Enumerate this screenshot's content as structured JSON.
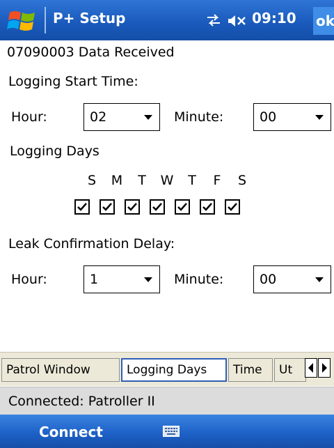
{
  "titlebar": {
    "title": "P+ Setup",
    "time": "09:10",
    "ok_label": "ok",
    "icons": [
      "windows-start-icon",
      "connectivity-icon",
      "volume-muted-icon"
    ]
  },
  "status_message": "07090003 Data Received",
  "logging_start": {
    "label": "Logging Start Time:",
    "hour_label": "Hour:",
    "hour_value": "02",
    "minute_label": "Minute:",
    "minute_value": "00"
  },
  "logging_days": {
    "label": "Logging Days",
    "days": [
      {
        "letter": "S",
        "checked": true
      },
      {
        "letter": "M",
        "checked": true
      },
      {
        "letter": "T",
        "checked": true
      },
      {
        "letter": "W",
        "checked": true
      },
      {
        "letter": "T",
        "checked": true
      },
      {
        "letter": "F",
        "checked": true
      },
      {
        "letter": "S",
        "checked": true
      }
    ]
  },
  "leak_delay": {
    "label": "Leak Confirmation Delay:",
    "hour_label": "Hour:",
    "hour_value": "1",
    "minute_label": "Minute:",
    "minute_value": "00"
  },
  "tabs": [
    {
      "label": "Patrol Window",
      "active": false
    },
    {
      "label": "Logging Days",
      "active": true
    },
    {
      "label": "Time",
      "active": false
    },
    {
      "label": "Ut",
      "active": false
    }
  ],
  "connection_status": "Connected: Patroller II",
  "menu": {
    "connect_label": "Connect",
    "keyboard_icon": "keyboard-icon"
  },
  "colors": {
    "titlebar": "#1b5bbd",
    "menubar": "#1c5fc5",
    "active_tab_border": "#2d5fb5",
    "tab_bg": "#ece9d8",
    "status_bg": "#dcdcdc"
  }
}
